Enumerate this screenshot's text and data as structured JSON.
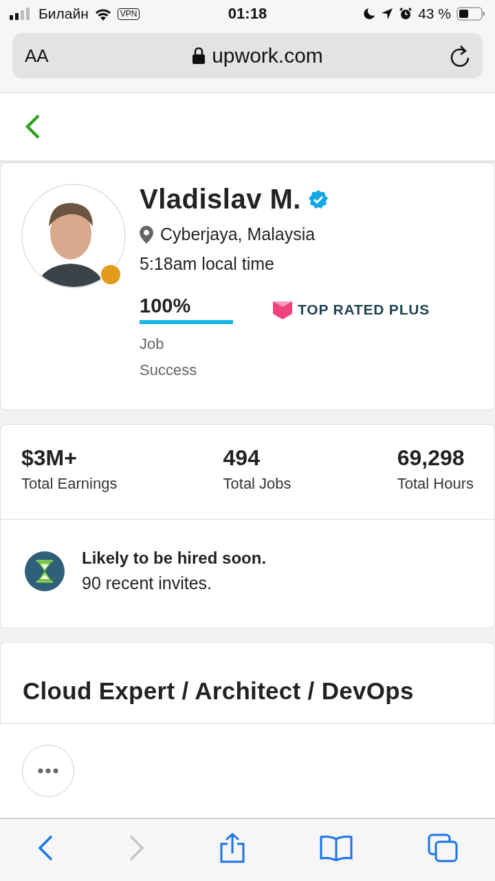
{
  "status_bar": {
    "carrier": "Билайн",
    "vpn": "VPN",
    "time": "01:18",
    "battery": "43 %"
  },
  "address_bar": {
    "text_size": "AA",
    "url": "upwork.com"
  },
  "profile": {
    "name": "Vladislav M.",
    "verified": true,
    "location": "Cyberjaya, Malaysia",
    "local_time": "5:18am local time",
    "job_success": {
      "value": "100%",
      "level": 1,
      "label_lines": [
        "Job",
        "Success"
      ]
    },
    "badge": "TOP RATED PLUS"
  },
  "stats": [
    {
      "value": "$3M+",
      "label": "Total Earnings"
    },
    {
      "value": "494",
      "label": "Total Jobs"
    },
    {
      "value": "69,298",
      "label": "Total Hours"
    }
  ],
  "hire_notice": {
    "title": "Likely to be hired soon.",
    "subtitle": "90 recent invites."
  },
  "headline": "Cloud Expert / Architect / DevOps",
  "browser_toolbar": {
    "back_enabled": true,
    "forward_enabled": false
  }
}
